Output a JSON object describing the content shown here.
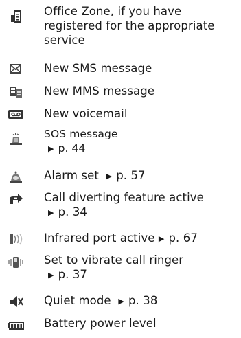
{
  "items": [
    {
      "icon": "office-zone-icon",
      "lines": [
        "Office Zone, if you have",
        "registered for the appropriate",
        "service"
      ]
    },
    {
      "icon": "envelope-icon",
      "lines": [
        "New SMS message"
      ]
    },
    {
      "icon": "mms-icon",
      "lines": [
        "New MMS message"
      ]
    },
    {
      "icon": "voicemail-icon",
      "lines": [
        "New voicemail"
      ]
    },
    {
      "icon": "sos-icon",
      "lines": [
        "SOS message"
      ],
      "ref": "p. 44"
    },
    {
      "icon": "alarm-icon",
      "lines": [
        "Alarm set"
      ],
      "ref": "p. 57"
    },
    {
      "icon": "call-divert-icon",
      "lines": [
        "Call diverting feature active"
      ],
      "ref": "p. 34"
    },
    {
      "icon": "infrared-icon",
      "lines": [
        "Infrared port active"
      ],
      "ref": "p. 67"
    },
    {
      "icon": "vibrate-icon",
      "lines": [
        "Set to vibrate call ringer"
      ],
      "ref": "p. 37"
    },
    {
      "icon": "quiet-mode-icon",
      "lines": [
        "Quiet mode"
      ],
      "ref": "p. 38"
    },
    {
      "icon": "battery-icon",
      "lines": [
        "Battery power level"
      ]
    }
  ]
}
